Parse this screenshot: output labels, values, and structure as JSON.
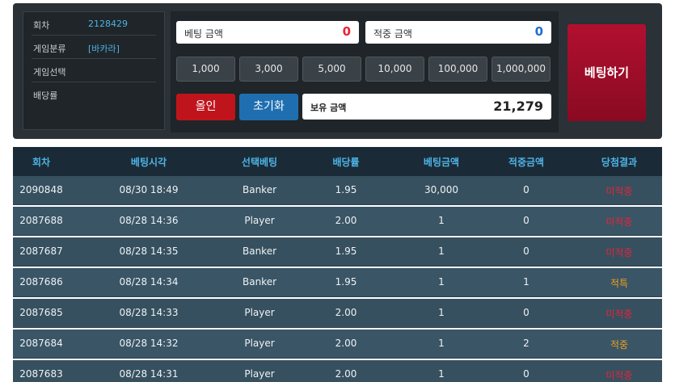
{
  "info": {
    "rows": [
      {
        "label": "회차",
        "value": "2128429"
      },
      {
        "label": "게임분류",
        "value": "[바카라]"
      },
      {
        "label": "게임선택",
        "value": ""
      },
      {
        "label": "배당률",
        "value": ""
      }
    ]
  },
  "bet": {
    "bet_amount_label": "베팅 금액",
    "bet_amount_value": "0",
    "win_amount_label": "적중 금액",
    "win_amount_value": "0",
    "chips": [
      "1,000",
      "3,000",
      "5,000",
      "10,000",
      "100,000",
      "1,000,000"
    ],
    "allin_label": "올인",
    "reset_label": "초기화",
    "holding_label": "보유 금액",
    "holding_value": "21,279",
    "bet_button_label": "베팅하기"
  },
  "table": {
    "headers": [
      "회차",
      "베팅시각",
      "선택베팅",
      "배당률",
      "베팅금액",
      "적중금액",
      "당첨결과"
    ],
    "rows": [
      [
        "2090848",
        "08/30 18:49",
        "Banker",
        "1.95",
        "30,000",
        "0",
        "미적중"
      ],
      [
        "2087688",
        "08/28 14:36",
        "Player",
        "2.00",
        "1",
        "0",
        "미적중"
      ],
      [
        "2087687",
        "08/28 14:35",
        "Banker",
        "1.95",
        "1",
        "0",
        "미적중"
      ],
      [
        "2087686",
        "08/28 14:34",
        "Banker",
        "1.95",
        "1",
        "1",
        "적특"
      ],
      [
        "2087685",
        "08/28 14:33",
        "Player",
        "2.00",
        "1",
        "0",
        "미적중"
      ],
      [
        "2087684",
        "08/28 14:32",
        "Player",
        "2.00",
        "1",
        "2",
        "적중"
      ],
      [
        "2087683",
        "08/28 14:31",
        "Player",
        "2.00",
        "1",
        "0",
        "미적중"
      ]
    ]
  },
  "colors": {
    "accent": "#4fb3e6",
    "lose": "#e8233a",
    "win": "#f0a020",
    "bet_button": "#a30d2a",
    "allin": "#c0141c",
    "reset": "#1f6fb0"
  }
}
